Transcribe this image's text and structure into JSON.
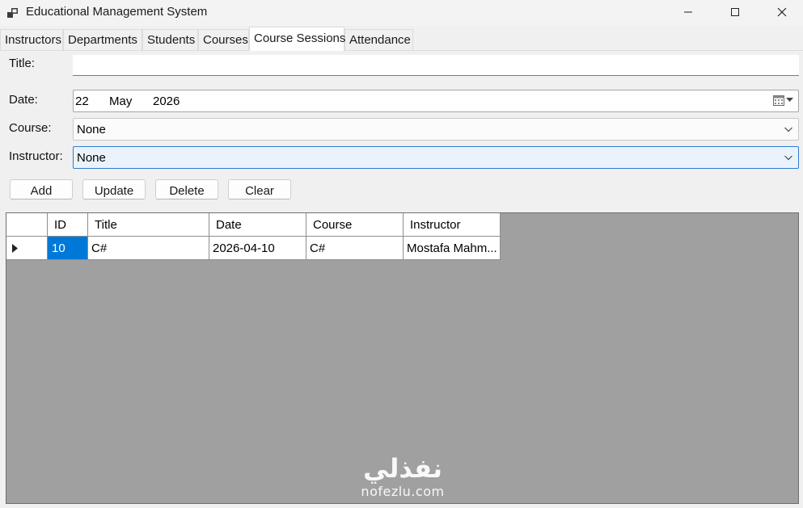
{
  "window": {
    "title": "Educational Management System",
    "icon": "app-window-icon"
  },
  "tabs": [
    {
      "label": "Instructors",
      "active": false
    },
    {
      "label": "Departments",
      "active": false
    },
    {
      "label": "Students",
      "active": false
    },
    {
      "label": "Courses",
      "active": false
    },
    {
      "label": "Course Sessions",
      "active": true
    },
    {
      "label": "Attendance",
      "active": false
    }
  ],
  "form": {
    "title_label": "Title:",
    "title_value": "",
    "date_label": "Date:",
    "date_day": "22",
    "date_month": "May",
    "date_year": "2026",
    "course_label": "Course:",
    "course_value": "None",
    "instructor_label": "Instructor:",
    "instructor_value": "None"
  },
  "buttons": {
    "add": "Add",
    "update": "Update",
    "delete": "Delete",
    "clear": "Clear"
  },
  "grid": {
    "columns": [
      "ID",
      "Title",
      "Date",
      "Course",
      "Instructor"
    ],
    "rows": [
      {
        "id": "10",
        "title": "C#",
        "date": "2026-04-10",
        "course": "C#",
        "instructor": "Mostafa Mahm..."
      }
    ]
  },
  "watermark": {
    "arabic": "نفذلي",
    "latin": "nofezlu.com"
  },
  "colors": {
    "selection": "#0078d7",
    "grid_background": "#a0a0a0",
    "focus_border": "#2f7ad3"
  }
}
